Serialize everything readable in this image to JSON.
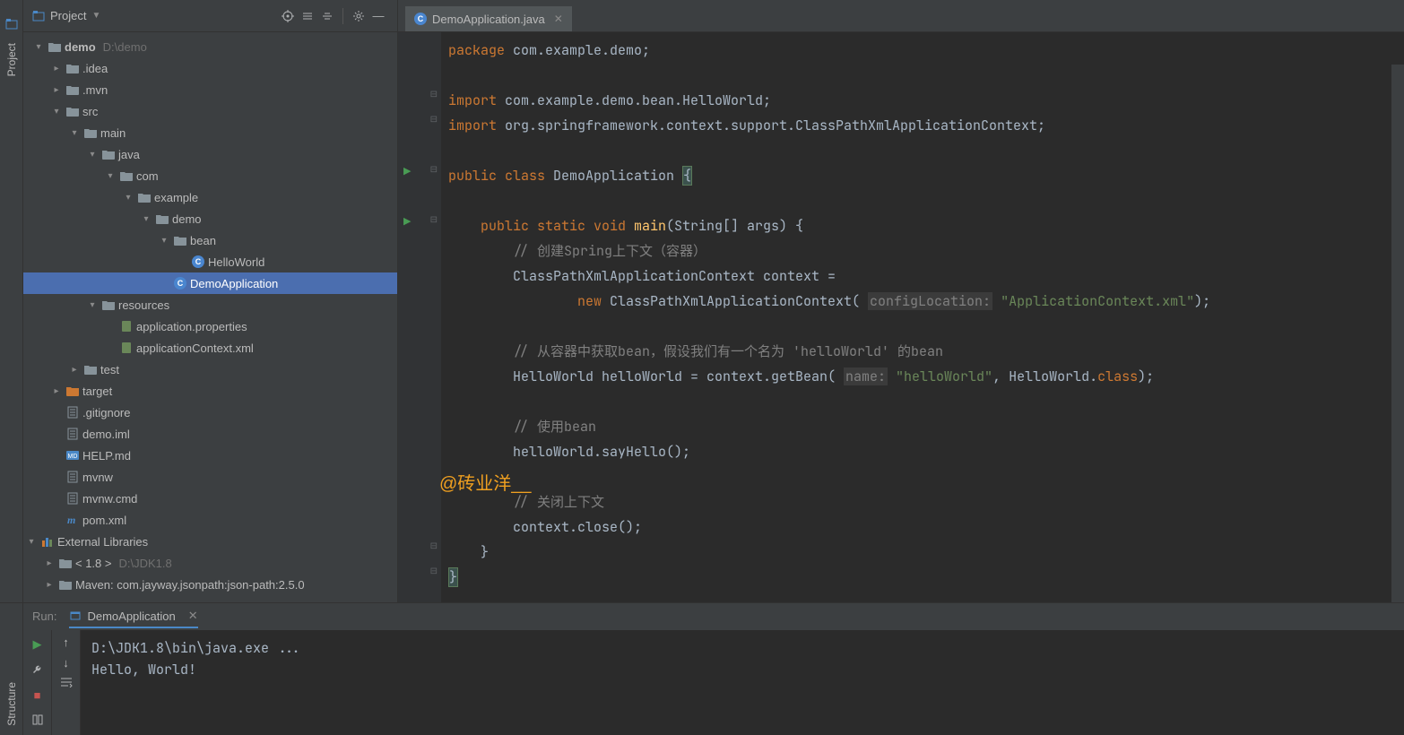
{
  "sidebar": {
    "project_tab": "Project",
    "structure_tab": "Structure"
  },
  "panel": {
    "title": "Project"
  },
  "tree": {
    "root": {
      "name": "demo",
      "path": "D:\\demo"
    },
    "items": [
      {
        "indent": 1,
        "arrow": "▸",
        "type": "folder",
        "name": ".idea"
      },
      {
        "indent": 1,
        "arrow": "▸",
        "type": "folder",
        "name": ".mvn"
      },
      {
        "indent": 1,
        "arrow": "▾",
        "type": "folder",
        "name": "src"
      },
      {
        "indent": 2,
        "arrow": "▾",
        "type": "folder",
        "name": "main"
      },
      {
        "indent": 3,
        "arrow": "▾",
        "type": "folder-src",
        "name": "java"
      },
      {
        "indent": 4,
        "arrow": "▾",
        "type": "pkg",
        "name": "com"
      },
      {
        "indent": 5,
        "arrow": "▾",
        "type": "pkg",
        "name": "example"
      },
      {
        "indent": 6,
        "arrow": "▾",
        "type": "pkg",
        "name": "demo"
      },
      {
        "indent": 7,
        "arrow": "▾",
        "type": "pkg",
        "name": "bean"
      },
      {
        "indent": 8,
        "arrow": "",
        "type": "class",
        "name": "HelloWorld"
      },
      {
        "indent": 7,
        "arrow": "",
        "type": "class",
        "name": "DemoApplication",
        "selected": true
      },
      {
        "indent": 3,
        "arrow": "▾",
        "type": "folder-res",
        "name": "resources"
      },
      {
        "indent": 4,
        "arrow": "",
        "type": "props",
        "name": "application.properties"
      },
      {
        "indent": 4,
        "arrow": "",
        "type": "xml",
        "name": "applicationContext.xml"
      },
      {
        "indent": 2,
        "arrow": "▸",
        "type": "folder",
        "name": "test"
      },
      {
        "indent": 1,
        "arrow": "▸",
        "type": "folder-target",
        "name": "target"
      },
      {
        "indent": 1,
        "arrow": "",
        "type": "file",
        "name": ".gitignore"
      },
      {
        "indent": 1,
        "arrow": "",
        "type": "file",
        "name": "demo.iml"
      },
      {
        "indent": 1,
        "arrow": "",
        "type": "md",
        "name": "HELP.md"
      },
      {
        "indent": 1,
        "arrow": "",
        "type": "file",
        "name": "mvnw"
      },
      {
        "indent": 1,
        "arrow": "",
        "type": "file",
        "name": "mvnw.cmd"
      },
      {
        "indent": 1,
        "arrow": "",
        "type": "maven",
        "name": "pom.xml"
      }
    ],
    "ext_lib": "External Libraries",
    "jdk": {
      "name": "< 1.8 >",
      "path": "D:\\JDK1.8"
    },
    "maven": "Maven: com.jayway.jsonpath:json-path:2.5.0"
  },
  "editor": {
    "tab": "DemoApplication.java",
    "watermark": "@砖业洋__",
    "lines": {
      "l1a": "package",
      "l1b": " com.example.demo;",
      "l3a": "import",
      "l3b": " com.example.demo.bean.HelloWorld;",
      "l4a": "import",
      "l4b": " org.springframework.context.support.ClassPathXmlApplicationContext;",
      "l6a": "public class ",
      "l6b": "DemoApplication ",
      "l6c": "{",
      "l8a": "    public static void ",
      "l8b": "main",
      "l8c": "(String[] args) {",
      "l9": "        // 创建Spring上下文（容器）",
      "l10": "        ClassPathXmlApplicationContext context =",
      "l11a": "                new ",
      "l11b": "ClassPathXmlApplicationContext( ",
      "l11p": "configLocation:",
      "l11c": " ",
      "l11s": "\"ApplicationContext.xml\"",
      "l11d": ");",
      "l13": "        // 从容器中获取bean，假设我们有一个名为 'helloWorld' 的bean",
      "l14a": "        HelloWorld helloWorld = context.getBean( ",
      "l14p": "name:",
      "l14b": " ",
      "l14s": "\"helloWorld\"",
      "l14c": ", HelloWorld.",
      "l14d": "class",
      "l14e": ");",
      "l16": "        // 使用bean",
      "l17": "        helloWorld.sayHello();",
      "l19": "        // 关闭上下文",
      "l20": "        context.close();",
      "l21": "    }",
      "l22": "}"
    }
  },
  "run": {
    "label": "Run:",
    "config": "DemoApplication",
    "out1": "D:\\JDK1.8\\bin\\java.exe ...",
    "out2": "Hello, World!"
  }
}
